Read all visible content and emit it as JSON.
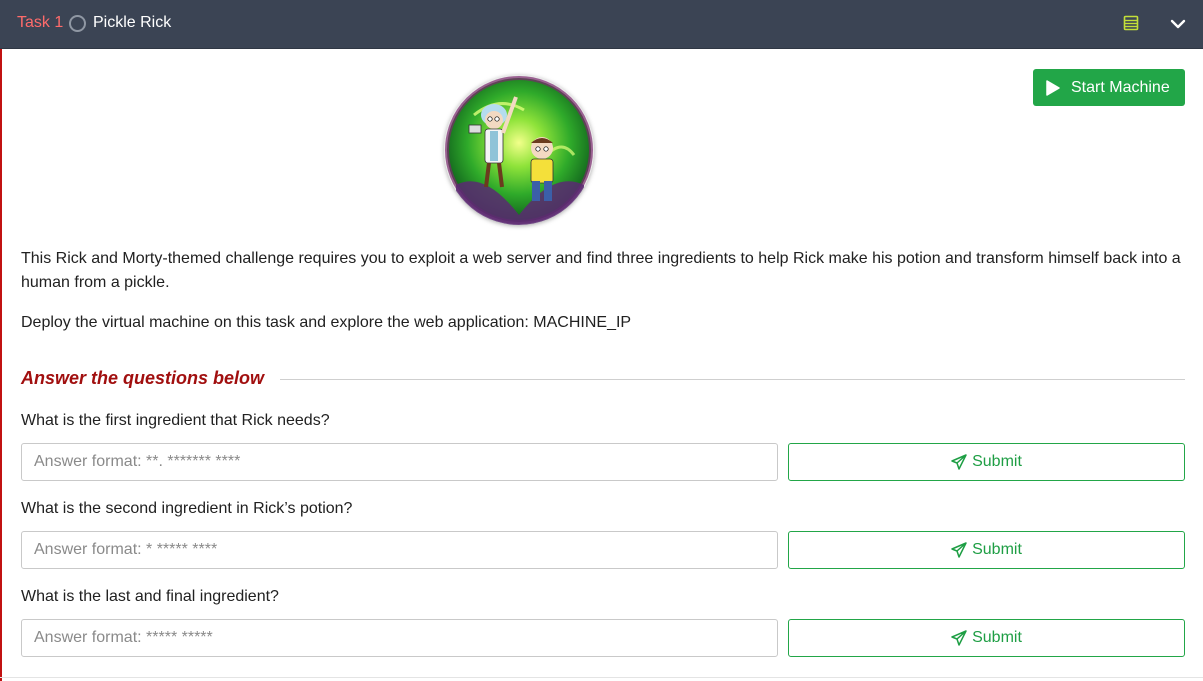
{
  "header": {
    "task_number": "Task 1",
    "task_title": "Pickle Rick",
    "icons": [
      "task-status-circle-icon",
      "notes-list-icon",
      "chevron-down-icon"
    ]
  },
  "start_machine": {
    "label": "Start Machine",
    "icon": "play-icon"
  },
  "room_image": {
    "alt": "Rick and Morty portal"
  },
  "content": {
    "description": "This Rick and Morty-themed challenge requires you to exploit a web server and find three ingredients to help Rick make his potion and transform himself back into a human from a pickle.",
    "deploy_text": "Deploy the virtual machine on this task and explore the web application: MACHINE_IP"
  },
  "questions_heading": "Answer the questions below",
  "questions": [
    {
      "text": "What is the first ingredient that Rick needs?",
      "placeholder": "Answer format: **. ******* ****",
      "value": "",
      "submit_label": "Submit"
    },
    {
      "text": "What is the second ingredient in Rick’s potion?",
      "placeholder": "Answer format: * ***** ****",
      "value": "",
      "submit_label": "Submit"
    },
    {
      "text": "What is the last and final ingredient?",
      "placeholder": "Answer format: ***** *****",
      "value": "",
      "submit_label": "Submit"
    }
  ],
  "colors": {
    "header_bg": "#3b4454",
    "task_number": "#ff6b6b",
    "accent_green": "#22a648",
    "heading_red": "#a10f0f",
    "panel_border": "#c11111",
    "icon_yellow": "#c3df39"
  }
}
